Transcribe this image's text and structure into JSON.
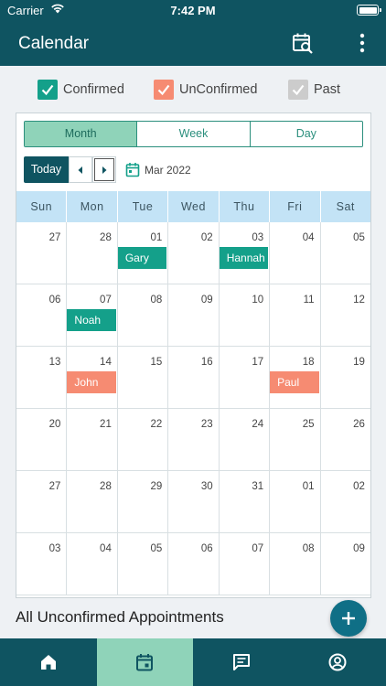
{
  "status": {
    "carrier": "Carrier",
    "time": "7:42 PM"
  },
  "header": {
    "title": "Calendar",
    "search_icon": "calendar-search-icon",
    "more_icon": "more-vertical-icon"
  },
  "legend": [
    {
      "label": "Confirmed",
      "color": "#14a08a"
    },
    {
      "label": "UnConfirmed",
      "color": "#f68b72"
    },
    {
      "label": "Past",
      "color": "#cccccc"
    }
  ],
  "views": {
    "month": "Month",
    "week": "Week",
    "day": "Day",
    "active": "month"
  },
  "nav": {
    "today": "Today",
    "month_label": "Mar 2022"
  },
  "weekdays": [
    "Sun",
    "Mon",
    "Tue",
    "Wed",
    "Thu",
    "Fri",
    "Sat"
  ],
  "weeks": [
    [
      "27",
      "28",
      "01",
      "02",
      "03",
      "04",
      "05"
    ],
    [
      "06",
      "07",
      "08",
      "09",
      "10",
      "11",
      "12"
    ],
    [
      "13",
      "14",
      "15",
      "16",
      "17",
      "18",
      "19"
    ],
    [
      "20",
      "21",
      "22",
      "23",
      "24",
      "25",
      "26"
    ],
    [
      "27",
      "28",
      "29",
      "30",
      "31",
      "01",
      "02"
    ],
    [
      "03",
      "04",
      "05",
      "06",
      "07",
      "08",
      "09"
    ]
  ],
  "appointments": [
    {
      "week": 0,
      "day": 2,
      "name": "Gary",
      "status": "confirmed"
    },
    {
      "week": 0,
      "day": 4,
      "name": "Hannah",
      "status": "confirmed"
    },
    {
      "week": 1,
      "day": 1,
      "name": "Noah",
      "status": "confirmed"
    },
    {
      "week": 2,
      "day": 1,
      "name": "John",
      "status": "unconfirmed"
    },
    {
      "week": 2,
      "day": 5,
      "name": "Paul",
      "status": "unconfirmed"
    }
  ],
  "colors": {
    "confirmed": "#14a08a",
    "unconfirmed": "#f68b72",
    "past": "#cccccc",
    "primary": "#0f5461",
    "accent": "#8fd3b9"
  },
  "section": {
    "title": "All Unconfirmed Appointments"
  },
  "tabs": [
    {
      "name": "home",
      "icon": "home-icon"
    },
    {
      "name": "calendar",
      "icon": "calendar-icon",
      "active": true
    },
    {
      "name": "messages",
      "icon": "message-icon"
    },
    {
      "name": "profile",
      "icon": "profile-icon"
    }
  ]
}
